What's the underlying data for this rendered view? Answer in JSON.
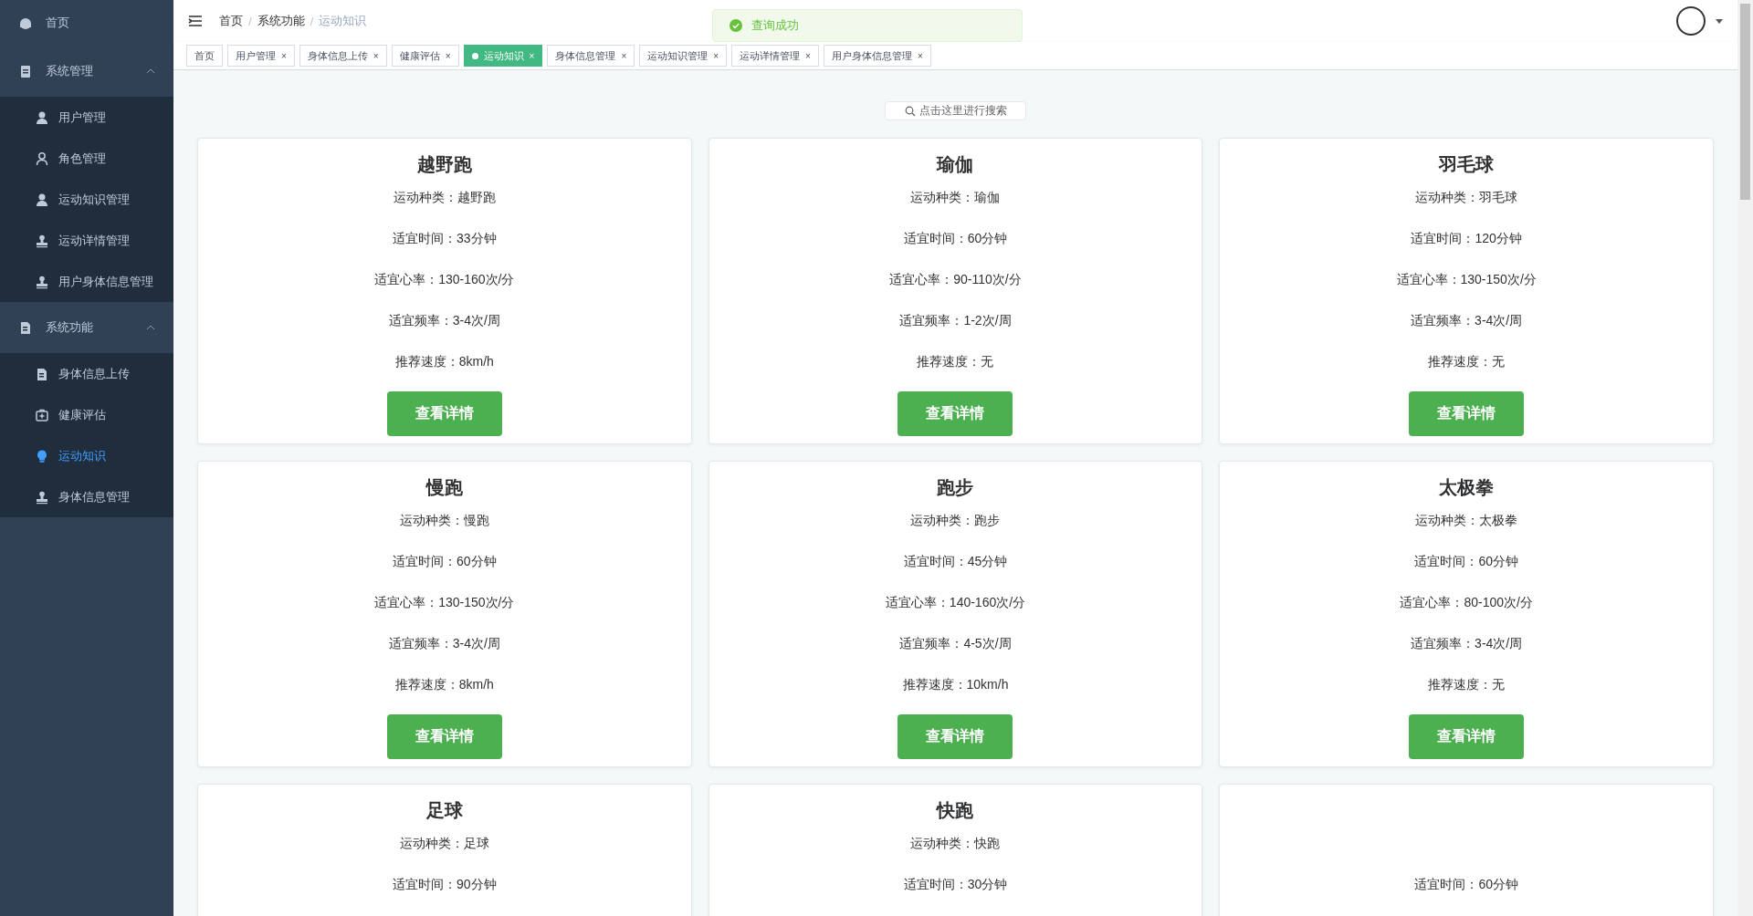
{
  "sidebar": {
    "items": [
      {
        "label": "首页",
        "selected": false
      },
      {
        "label": "系统管理",
        "expanded": true,
        "children": [
          {
            "label": "用户管理",
            "selected": false
          },
          {
            "label": "角色管理",
            "selected": false
          },
          {
            "label": "运动知识管理",
            "selected": false
          },
          {
            "label": "运动详情管理",
            "selected": false
          },
          {
            "label": "用户身体信息管理",
            "selected": false
          }
        ]
      },
      {
        "label": "系统功能",
        "expanded": true,
        "children": [
          {
            "label": "身体信息上传",
            "selected": false
          },
          {
            "label": "健康评估",
            "selected": false
          },
          {
            "label": "运动知识",
            "selected": true
          },
          {
            "label": "身体信息管理",
            "selected": false
          }
        ]
      }
    ]
  },
  "breadcrumb": {
    "items": [
      "首页",
      "系统功能",
      "运动知识"
    ],
    "separator": "/"
  },
  "tabs": [
    {
      "label": "首页",
      "selected": false
    },
    {
      "label": "用户管理",
      "close": "×",
      "selected": false
    },
    {
      "label": "身体信息上传",
      "close": "×",
      "selected": false
    },
    {
      "label": "健康评估",
      "close": "×",
      "selected": false
    },
    {
      "label": "运动知识",
      "close": "×",
      "selected": true
    },
    {
      "label": "身体信息管理",
      "close": "×",
      "selected": false
    },
    {
      "label": "运动知识管理",
      "close": "×",
      "selected": false
    },
    {
      "label": "运动详情管理",
      "close": "×",
      "selected": false
    },
    {
      "label": "用户身体信息管理",
      "close": "×",
      "selected": false
    }
  ],
  "toast": {
    "message": "查询成功"
  },
  "search": {
    "label": "点击这里进行搜索"
  },
  "cards": [
    {
      "kind": "full",
      "title": "越野跑",
      "rows": [
        "运动种类：越野跑",
        "适宜时间：33分钟",
        "适宜心率：130-160次/分",
        "适宜频率：3-4次/周",
        "推荐速度：8km/h"
      ],
      "button": "查看详情"
    },
    {
      "kind": "full",
      "title": "瑜伽",
      "rows": [
        "运动种类：瑜伽",
        "适宜时间：60分钟",
        "适宜心率：90-110次/分",
        "适宜频率：1-2次/周",
        "推荐速度：无"
      ],
      "button": "查看详情"
    },
    {
      "kind": "full",
      "title": "羽毛球",
      "rows": [
        "运动种类：羽毛球",
        "适宜时间：120分钟",
        "适宜心率：130-150次/分",
        "适宜频率：3-4次/周",
        "推荐速度：无"
      ],
      "button": "查看详情"
    },
    {
      "kind": "full",
      "title": "慢跑",
      "rows": [
        "运动种类：慢跑",
        "适宜时间：60分钟",
        "适宜心率：130-150次/分",
        "适宜频率：3-4次/周",
        "推荐速度：8km/h"
      ],
      "button": "查看详情"
    },
    {
      "kind": "full",
      "title": "跑步",
      "rows": [
        "运动种类：跑步",
        "适宜时间：45分钟",
        "适宜心率：140-160次/分",
        "适宜频率：4-5次/周",
        "推荐速度：10km/h"
      ],
      "button": "查看详情"
    },
    {
      "kind": "full",
      "title": "太极拳",
      "rows": [
        "运动种类：太极拳",
        "适宜时间：60分钟",
        "适宜心率：80-100次/分",
        "适宜频率：3-4次/周",
        "推荐速度：无"
      ],
      "button": "查看详情"
    },
    {
      "kind": "full",
      "title": "足球",
      "rows": [
        "运动种类：足球",
        "适宜时间：90分钟"
      ]
    },
    {
      "kind": "full",
      "title": "快跑",
      "rows": [
        "运动种类：快跑",
        "适宜时间：30分钟"
      ]
    },
    {
      "kind": "partial",
      "rows": [
        "适宜时间：60分钟"
      ]
    }
  ]
}
